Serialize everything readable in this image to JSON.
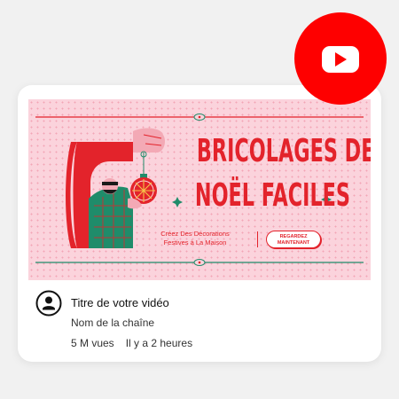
{
  "thumbnail": {
    "title_line1": "BRICOLAGES DE",
    "title_line2": "NOËL FACILES",
    "subtitle_line1": "Créez Des Décorations",
    "subtitle_line2": "Festives à La Maison",
    "cta_line1": "REGARDEZ",
    "cta_line2": "MAINTENANT"
  },
  "video": {
    "title": "Titre de votre vidéo",
    "channel": "Nom de la chaîne",
    "views": "5 M vues",
    "time": "Il y a 2 heures"
  },
  "icons": {
    "badge": "youtube-play-icon",
    "avatar": "user-avatar-icon"
  },
  "colors": {
    "brand_red": "#fe0000",
    "thumb_pink": "#fbd3dc",
    "title_red": "#e3232b",
    "accent_green": "#1f8c6a"
  }
}
